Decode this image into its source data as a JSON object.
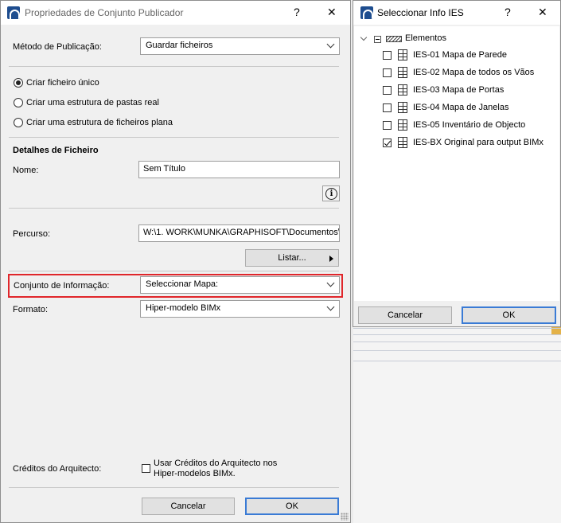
{
  "main_dialog": {
    "title": "Propriedades de Conjunto Publicador",
    "help": "?",
    "close": "✕",
    "publish_method_label": "Método de Publicação:",
    "publish_method_value": "Guardar ficheiros",
    "radios": [
      "Criar ficheiro único",
      "Criar uma estrutura de pastas real",
      "Criar uma estrutura de ficheiros plana"
    ],
    "file_details_heading": "Detalhes de Ficheiro",
    "name_label": "Nome:",
    "name_value": "Sem Título",
    "path_label": "Percurso:",
    "path_value": "W:\\1. WORK\\MUNKA\\GRAPHISOFT\\Documentos\\",
    "browse_label": "Listar...",
    "info_set_label": "Conjunto de Informação:",
    "info_set_value": "Seleccionar Mapa:",
    "format_label": "Formato:",
    "format_value": "Hiper-modelo BIMx",
    "credits_label": "Créditos do Arquitecto:",
    "credits_checkbox_text": "Usar Créditos do Arquitecto nos Hiper-modelos BIMx.",
    "cancel": "Cancelar",
    "ok": "OK"
  },
  "ies_dialog": {
    "title": "Seleccionar Info IES",
    "help": "?",
    "close": "✕",
    "root": "Elementos",
    "items": [
      {
        "label": "IES-01 Mapa de Parede",
        "checked": false
      },
      {
        "label": "IES-02 Mapa de todos os Vãos",
        "checked": false
      },
      {
        "label": "IES-03 Mapa de Portas",
        "checked": false
      },
      {
        "label": "IES-04 Mapa de Janelas",
        "checked": false
      },
      {
        "label": "IES-05 Inventário de Objecto",
        "checked": false
      },
      {
        "label": "IES-BX Original para output BIMx",
        "checked": true
      }
    ],
    "cancel": "Cancelar",
    "ok": "OK"
  },
  "colors": {
    "accent": "#3a7bd5",
    "highlight": "#e0262b",
    "app_icon": "#1e4d8f"
  }
}
